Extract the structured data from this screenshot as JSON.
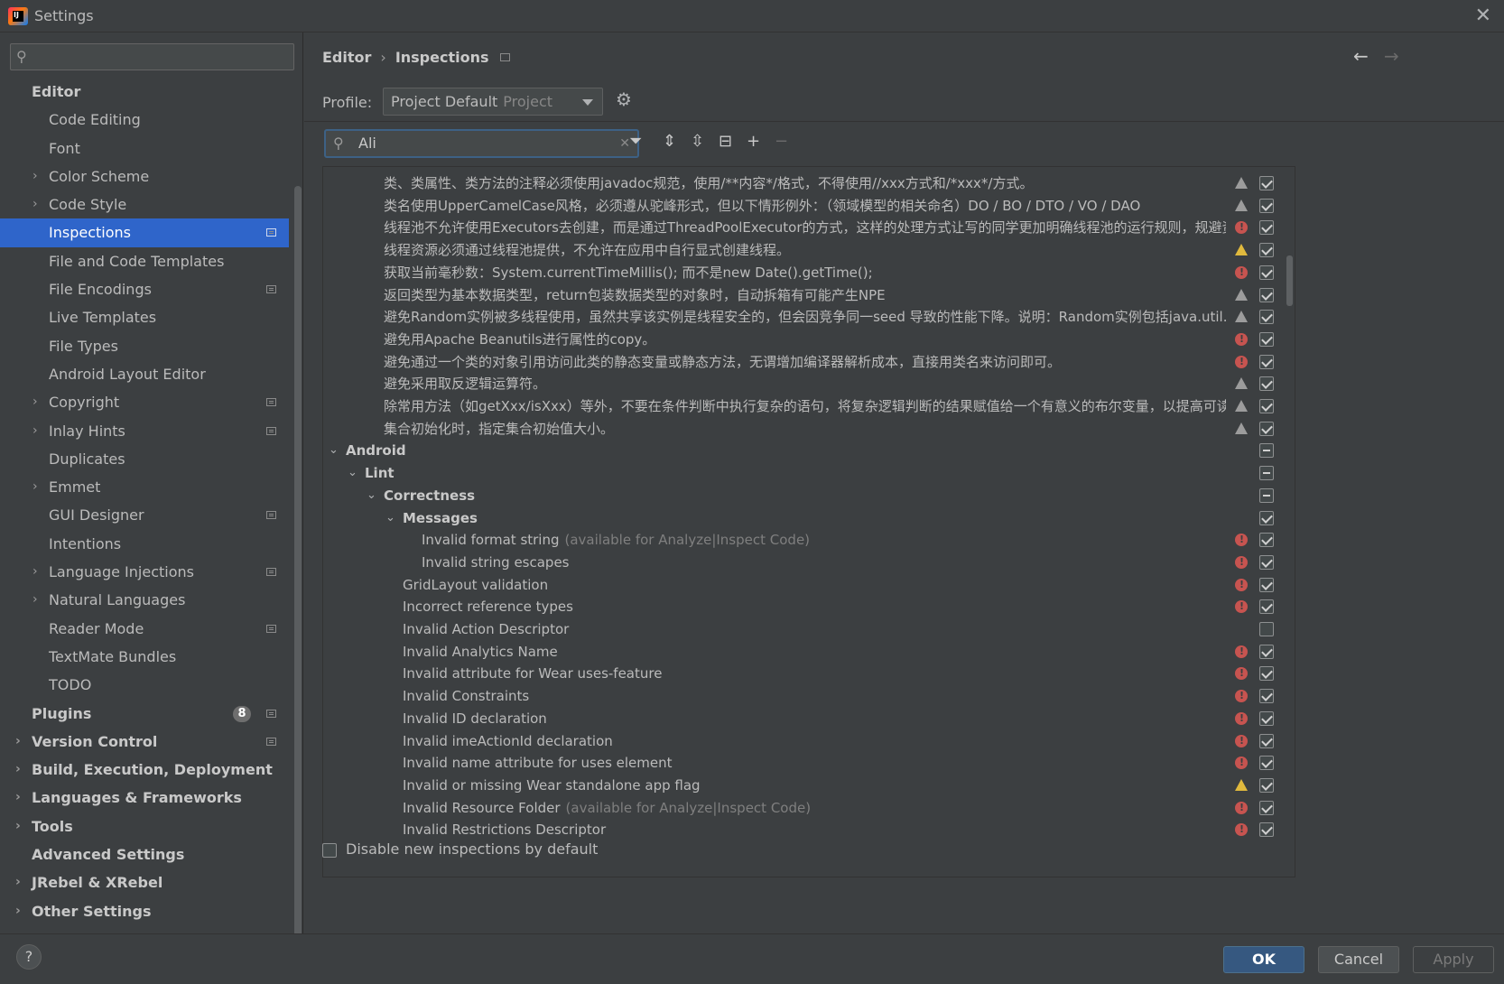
{
  "window": {
    "title": "Settings"
  },
  "sidebar": {
    "search_placeholder": "",
    "items": [
      {
        "label": "Editor",
        "level": 0,
        "bold": true,
        "chevron": false,
        "proj": false
      },
      {
        "label": "Code Editing",
        "level": 1,
        "chevron": false,
        "proj": false
      },
      {
        "label": "Font",
        "level": 1,
        "chevron": false,
        "proj": false
      },
      {
        "label": "Color Scheme",
        "level": 1,
        "chevron": true,
        "proj": false
      },
      {
        "label": "Code Style",
        "level": 1,
        "chevron": true,
        "proj": false
      },
      {
        "label": "Inspections",
        "level": 1,
        "chevron": false,
        "proj": true,
        "selected": true
      },
      {
        "label": "File and Code Templates",
        "level": 1,
        "chevron": false,
        "proj": false
      },
      {
        "label": "File Encodings",
        "level": 1,
        "chevron": false,
        "proj": true
      },
      {
        "label": "Live Templates",
        "level": 1,
        "chevron": false,
        "proj": false
      },
      {
        "label": "File Types",
        "level": 1,
        "chevron": false,
        "proj": false
      },
      {
        "label": "Android Layout Editor",
        "level": 1,
        "chevron": false,
        "proj": false
      },
      {
        "label": "Copyright",
        "level": 1,
        "chevron": true,
        "proj": true
      },
      {
        "label": "Inlay Hints",
        "level": 1,
        "chevron": true,
        "proj": true
      },
      {
        "label": "Duplicates",
        "level": 1,
        "chevron": false,
        "proj": false
      },
      {
        "label": "Emmet",
        "level": 1,
        "chevron": true,
        "proj": false
      },
      {
        "label": "GUI Designer",
        "level": 1,
        "chevron": false,
        "proj": true
      },
      {
        "label": "Intentions",
        "level": 1,
        "chevron": false,
        "proj": false
      },
      {
        "label": "Language Injections",
        "level": 1,
        "chevron": true,
        "proj": true
      },
      {
        "label": "Natural Languages",
        "level": 1,
        "chevron": true,
        "proj": false
      },
      {
        "label": "Reader Mode",
        "level": 1,
        "chevron": false,
        "proj": true
      },
      {
        "label": "TextMate Bundles",
        "level": 1,
        "chevron": false,
        "proj": false
      },
      {
        "label": "TODO",
        "level": 1,
        "chevron": false,
        "proj": false
      },
      {
        "label": "Plugins",
        "level": 0,
        "bold": true,
        "chevron": false,
        "proj": true,
        "badge": "8"
      },
      {
        "label": "Version Control",
        "level": 0,
        "bold": true,
        "chevron": true,
        "proj": true
      },
      {
        "label": "Build, Execution, Deployment",
        "level": 0,
        "bold": true,
        "chevron": true,
        "proj": false
      },
      {
        "label": "Languages & Frameworks",
        "level": 0,
        "bold": true,
        "chevron": true,
        "proj": false
      },
      {
        "label": "Tools",
        "level": 0,
        "bold": true,
        "chevron": true,
        "proj": false
      },
      {
        "label": "Advanced Settings",
        "level": 0,
        "bold": true,
        "chevron": false,
        "proj": false
      },
      {
        "label": "JRebel & XRebel",
        "level": 0,
        "bold": true,
        "chevron": true,
        "proj": false
      },
      {
        "label": "Other Settings",
        "level": 0,
        "bold": true,
        "chevron": true,
        "proj": false
      }
    ]
  },
  "header": {
    "crumb_parent": "Editor",
    "crumb_sep": "›",
    "crumb_current": "Inspections",
    "back": "←",
    "forward": "→"
  },
  "profile": {
    "label": "Profile:",
    "name": "Project Default",
    "scope": "Project"
  },
  "filter": {
    "value": "Ali"
  },
  "toolbar": {
    "filter": "⏷",
    "expand_all": "⇕",
    "collapse_all": "⇳",
    "collapse": "⊟",
    "add": "+",
    "remove": "−"
  },
  "tree": [
    {
      "text": "类、类属性、类方法的注释必须使用javadoc规范，使用/**内容*/格式，不得使用//xxx方式和/*xxx*/方式。",
      "level": 2,
      "sev": "warn",
      "check": "on"
    },
    {
      "text": "类名使用UpperCamelCase风格，必须遵从驼峰形式，但以下情形例外：（领域模型的相关命名）DO / BO / DTO / VO / DAO",
      "level": 2,
      "sev": "warn",
      "check": "on"
    },
    {
      "text": "线程池不允许使用Executors去创建，而是通过ThreadPoolExecutor的方式，这样的处理方式让写的同学更加明确线程池的运行规则，规避资源",
      "level": 2,
      "sev": "err",
      "check": "on"
    },
    {
      "text": "线程资源必须通过线程池提供，不允许在应用中自行显式创建线程。",
      "level": 2,
      "sev": "warn-y",
      "check": "on"
    },
    {
      "text": "获取当前毫秒数：System.currentTimeMillis(); 而不是new Date().getTime();",
      "level": 2,
      "sev": "err",
      "check": "on"
    },
    {
      "text": "返回类型为基本数据类型，return包装数据类型的对象时，自动拆箱有可能产生NPE",
      "level": 2,
      "sev": "warn",
      "check": "on"
    },
    {
      "text": "避免Random实例被多线程使用，虽然共享该实例是线程安全的，但会因竞争同一seed 导致的性能下降。说明：Random实例包括java.util.Ranc",
      "level": 2,
      "sev": "warn",
      "check": "on"
    },
    {
      "text": "避免用Apache Beanutils进行属性的copy。",
      "level": 2,
      "sev": "err",
      "check": "on"
    },
    {
      "text": "避免通过一个类的对象引用访问此类的静态变量或静态方法，无谓增加编译器解析成本，直接用类名来访问即可。",
      "level": 2,
      "sev": "err",
      "check": "on"
    },
    {
      "text": "避免采用取反逻辑运算符。",
      "level": 2,
      "sev": "warn",
      "check": "on"
    },
    {
      "text": "除常用方法（如getXxx/isXxx）等外，不要在条件判断中执行复杂的语句，将复杂逻辑判断的结果赋值给一个有意义的布尔变量，以提高可读性。",
      "level": 2,
      "sev": "warn",
      "check": "on"
    },
    {
      "text": "集合初始化时，指定集合初始值大小。",
      "level": 2,
      "sev": "warn",
      "check": "on"
    },
    {
      "text": "Android",
      "level": 0,
      "group": true,
      "sev": "",
      "check": "mixed"
    },
    {
      "text": "Lint",
      "level": 1,
      "group": true,
      "sev": "",
      "check": "mixed"
    },
    {
      "text": "Correctness",
      "level": 2,
      "group": true,
      "sev": "",
      "check": "mixed"
    },
    {
      "text": "Messages",
      "level": 3,
      "group": true,
      "sev": "",
      "check": "on"
    },
    {
      "text": "Invalid format string",
      "hint": "(available for Analyze|Inspect Code)",
      "level": 4,
      "sev": "err",
      "check": "on"
    },
    {
      "text": "Invalid string escapes",
      "level": 4,
      "sev": "err",
      "check": "on"
    },
    {
      "text": "GridLayout validation",
      "level": 3,
      "sev": "err",
      "check": "on"
    },
    {
      "text": "Incorrect reference types",
      "level": 3,
      "sev": "err",
      "check": "on"
    },
    {
      "text": "Invalid Action Descriptor",
      "level": 3,
      "sev": "",
      "check": "off"
    },
    {
      "text": "Invalid Analytics Name",
      "level": 3,
      "sev": "err",
      "check": "on"
    },
    {
      "text": "Invalid attribute for Wear uses-feature",
      "level": 3,
      "sev": "err",
      "check": "on"
    },
    {
      "text": "Invalid Constraints",
      "level": 3,
      "sev": "err",
      "check": "on"
    },
    {
      "text": "Invalid ID declaration",
      "level": 3,
      "sev": "err",
      "check": "on"
    },
    {
      "text": "Invalid imeActionId declaration",
      "level": 3,
      "sev": "err",
      "check": "on"
    },
    {
      "text": "Invalid name attribute for uses element",
      "level": 3,
      "sev": "err",
      "check": "on"
    },
    {
      "text": "Invalid or missing Wear standalone app flag",
      "level": 3,
      "sev": "warn-y",
      "check": "on"
    },
    {
      "text": "Invalid Resource Folder",
      "hint": "(available for Analyze|Inspect Code)",
      "level": 3,
      "sev": "err",
      "check": "on"
    },
    {
      "text": "Invalid Restrictions Descriptor",
      "level": 3,
      "sev": "err",
      "check": "on"
    }
  ],
  "options": {
    "disable_new": "Disable new inspections by default"
  },
  "footer": {
    "help": "?",
    "ok": "OK",
    "cancel": "Cancel",
    "apply": "Apply"
  },
  "colors": {
    "selection": "#2f65ca",
    "ok_button": "#365880",
    "error": "#c75450",
    "warning": "#e0b93d"
  }
}
